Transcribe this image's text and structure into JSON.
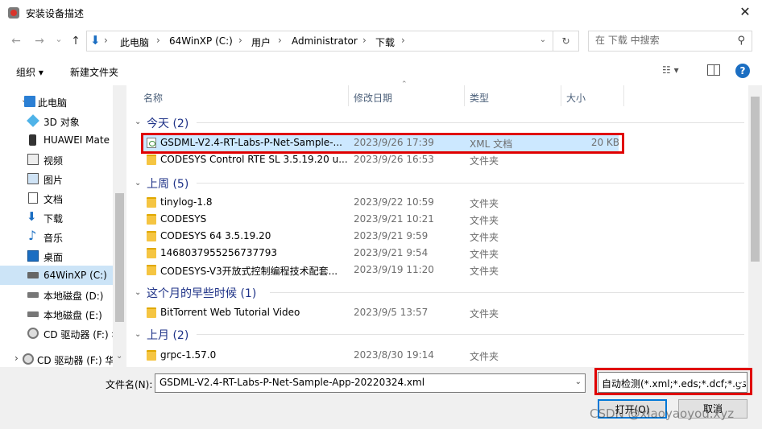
{
  "window": {
    "title": "安装设备描述",
    "close": "✕"
  },
  "nav": {
    "back": "←",
    "forward": "→",
    "recent": "⌄",
    "up": "↑",
    "refresh": "↻",
    "dropdown": "⌄",
    "breadcrumbs": [
      "此电脑",
      "64WinXP (C:)",
      "用户",
      "Administrator",
      "下载"
    ],
    "separators": [
      "›",
      "›",
      "›",
      "›",
      "›"
    ],
    "search_placeholder": "在 下载 中搜索",
    "search_icon": "⚲"
  },
  "toolbar": {
    "organize": "组织 ▾",
    "new_folder": "新建文件夹",
    "view": "☷ ▾",
    "help": "?"
  },
  "sidebar": {
    "items": [
      {
        "label": "此电脑",
        "icon": "computer"
      },
      {
        "label": "3D 对象",
        "icon": "3d-objects"
      },
      {
        "label": "HUAWEI Mate",
        "icon": "phone"
      },
      {
        "label": "视频",
        "icon": "video"
      },
      {
        "label": "图片",
        "icon": "pictures"
      },
      {
        "label": "文档",
        "icon": "documents"
      },
      {
        "label": "下载",
        "icon": "download"
      },
      {
        "label": "音乐",
        "icon": "music"
      },
      {
        "label": "桌面",
        "icon": "desktop"
      },
      {
        "label": "64WinXP   (C:)",
        "icon": "drive"
      },
      {
        "label": "本地磁盘 (D:)",
        "icon": "drive"
      },
      {
        "label": "本地磁盘 (E:)",
        "icon": "drive"
      },
      {
        "label": "CD 驱动器 (F:) 华",
        "icon": "cd-drive"
      },
      {
        "label": "CD 驱动器 (F:) 华",
        "icon": "cd-drive"
      }
    ],
    "expand_arrow": "›",
    "scroll_down": "⌄"
  },
  "columns": {
    "name": "名称",
    "date": "修改日期",
    "type": "类型",
    "size": "大小",
    "sort_arrow": "⌃"
  },
  "groups": [
    {
      "label": "今天 (2)",
      "files": [
        {
          "name": "GSDML-V2.4-RT-Labs-P-Net-Sample-...",
          "date": "2023/9/26 17:39",
          "type": "XML 文档",
          "size": "20 KB",
          "kind": "xml"
        },
        {
          "name": "CODESYS Control RTE SL 3.5.19.20 u...",
          "date": "2023/9/26 16:53",
          "type": "文件夹",
          "size": "",
          "kind": "folder"
        }
      ]
    },
    {
      "label": "上周 (5)",
      "files": [
        {
          "name": "tinylog-1.8",
          "date": "2023/9/22 10:59",
          "type": "文件夹",
          "size": "",
          "kind": "folder"
        },
        {
          "name": "CODESYS",
          "date": "2023/9/21 10:21",
          "type": "文件夹",
          "size": "",
          "kind": "folder"
        },
        {
          "name": "CODESYS 64 3.5.19.20",
          "date": "2023/9/21 9:59",
          "type": "文件夹",
          "size": "",
          "kind": "folder"
        },
        {
          "name": "1468037955256737793",
          "date": "2023/9/21 9:54",
          "type": "文件夹",
          "size": "",
          "kind": "folder"
        },
        {
          "name": "CODESYS-V3开放式控制编程技术配套...",
          "date": "2023/9/19 11:20",
          "type": "文件夹",
          "size": "",
          "kind": "folder"
        }
      ]
    },
    {
      "label": "这个月的早些时候 (1)",
      "files": [
        {
          "name": "BitTorrent Web Tutorial Video",
          "date": "2023/9/5 13:57",
          "type": "文件夹",
          "size": "",
          "kind": "folder"
        }
      ]
    },
    {
      "label": "上月 (2)",
      "files": [
        {
          "name": "grpc-1.57.0",
          "date": "2023/8/30 19:14",
          "type": "文件夹",
          "size": "",
          "kind": "folder"
        }
      ]
    }
  ],
  "bottom": {
    "filename_label": "文件名(N):",
    "filename_value": "GSDML-V2.4-RT-Labs-P-Net-Sample-App-20220324.xml",
    "filter_value": "自动检测(*.xml;*.eds;*.dcf;*.gsd",
    "dropdown_arrow": "⌄",
    "open_label": "打开(O)",
    "cancel_label": "取消"
  },
  "watermark": "CSDN @xiaoyaoyou.xyz",
  "colors": {
    "highlight": "#e00000",
    "selection": "#cce8ff",
    "group_text": "#1e3287",
    "accent": "#0078d7"
  }
}
